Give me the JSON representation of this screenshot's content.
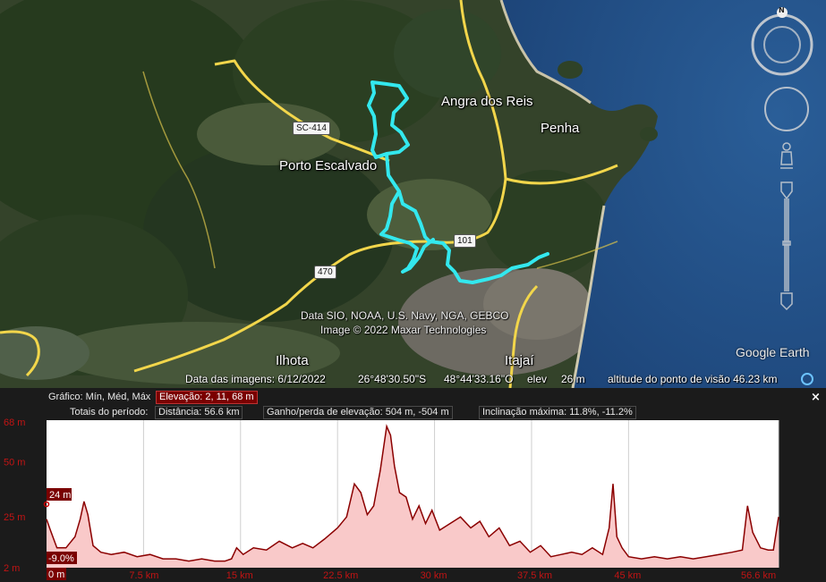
{
  "map": {
    "places": {
      "angra": "Angra dos Reis",
      "penha": "Penha",
      "porto": "Porto Escalvado",
      "ilhota": "Ilhota",
      "itajai": "Itajaí"
    },
    "roads": {
      "sc414": "SC-414",
      "br101": "101",
      "br470": "470"
    },
    "credits": {
      "line1": "Data SIO, NOAA, U.S. Navy, NGA, GEBCO",
      "line2": "Image © 2022 Maxar Technologies"
    },
    "logo": "Google Earth",
    "compass_letter": "N",
    "colors": {
      "track": "#33e8ee",
      "road": "#f2d64b",
      "water": "#1f4f86"
    }
  },
  "status": {
    "imagery_date": "Data das imagens: 6/12/2022",
    "lat": "26°48'30.50\"S",
    "lon": "48°44'33.16\"O",
    "elev_label": "elev",
    "elev_value": "26 m",
    "eye_alt": "altitude do ponto de visão  46.23 km"
  },
  "profile": {
    "graph_label": "Gráfico: Mín, Méd, Máx",
    "elevation_stat": "Elevação: 2, 11, 68 m",
    "totals_label": "Totais do período:",
    "distance_stat": "Distância: 56.6 km",
    "gain_loss_stat": "Ganho/perda de elevação: 504 m, -504 m",
    "max_slope_stat": "Inclinação máxima: 11.8%, -11.2%",
    "close": "×",
    "cursor_elev": "24 m",
    "cursor_slope": "-9.0%",
    "cursor_dist": "0 m"
  },
  "chart_data": {
    "type": "area",
    "xlabel": "",
    "ylabel": "",
    "x_ticks": [
      "7.5 km",
      "15 km",
      "22.5 km",
      "30 km",
      "37.5 km",
      "45 km",
      "56.6 km"
    ],
    "x_tick_values": [
      7.5,
      15,
      22.5,
      30,
      37.5,
      45,
      56.6
    ],
    "y_ticks": [
      "68 m",
      "50 m",
      "25 m",
      "2 m"
    ],
    "y_tick_values": [
      68,
      50,
      25,
      2
    ],
    "xlim": [
      0,
      56.6
    ],
    "ylim": [
      2,
      68
    ],
    "fill_color": "#f9c9c9",
    "line_color": "#8b0000",
    "series": [
      {
        "x": [
          0,
          0.3,
          0.8,
          1.5,
          2.2,
          2.6,
          2.9,
          3.2,
          3.6,
          4.2,
          5,
          6,
          7,
          8,
          9,
          10,
          11,
          12,
          13,
          13.8,
          14.3,
          14.7,
          15.2,
          16,
          17,
          18,
          19,
          19.8,
          20.6,
          21.5,
          22.5,
          23.2,
          23.8,
          24.3,
          24.8,
          25.3,
          25.8,
          26.3,
          26.6,
          26.9,
          27.3,
          27.8,
          28.3,
          28.8,
          29.3,
          29.8,
          30.4,
          31.2,
          32,
          32.8,
          33.5,
          34.2,
          35,
          35.8,
          36.6,
          37.4,
          38.2,
          39,
          39.8,
          40.6,
          41.4,
          42.2,
          43,
          43.5,
          43.8,
          44.1,
          44.5,
          45,
          46,
          47,
          48,
          49,
          50,
          51,
          52,
          53,
          53.8,
          54.2,
          54.6,
          55.2,
          55.8,
          56.2,
          56.6
        ],
        "y": [
          24,
          19,
          11,
          11,
          16,
          24,
          32,
          26,
          12,
          9,
          8,
          9,
          7,
          8,
          6,
          6,
          5,
          6,
          5,
          5,
          6,
          11,
          8,
          11,
          10,
          14,
          11,
          13,
          11,
          15,
          20,
          25,
          40,
          36,
          26,
          30,
          46,
          66,
          62,
          48,
          36,
          34,
          24,
          30,
          22,
          28,
          19,
          22,
          25,
          20,
          23,
          16,
          20,
          12,
          14,
          9,
          12,
          7,
          8,
          9,
          8,
          11,
          8,
          20,
          40,
          16,
          11,
          7,
          6,
          7,
          6,
          7,
          6,
          7,
          8,
          9,
          10,
          30,
          18,
          11,
          10,
          10,
          25
        ]
      }
    ]
  }
}
